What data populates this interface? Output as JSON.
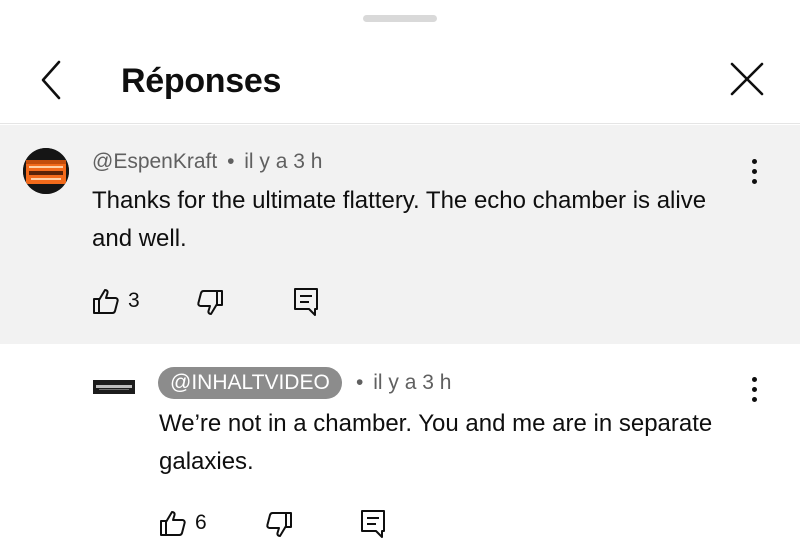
{
  "header": {
    "title": "Réponses",
    "back_icon": "chevron-left-icon",
    "close_icon": "close-icon"
  },
  "parent_comment": {
    "author": "@EspenKraft",
    "separator": "•",
    "time": "il y a 3 h",
    "text": "Thanks for the ultimate flattery. The echo chamber is alive and well.",
    "likes": "3"
  },
  "reply_comment": {
    "author": "@INHALTVIDEO",
    "separator": "•",
    "time": "il y a 3 h",
    "text": "We’re not in a chamber. You and me are in separate galaxies.",
    "likes": "6"
  },
  "colors": {
    "parent_bg": "#f2f2f2",
    "author_pill_bg": "#8c8c8c",
    "meta_text": "#606060",
    "avatar_accent": "#f26a1b"
  }
}
